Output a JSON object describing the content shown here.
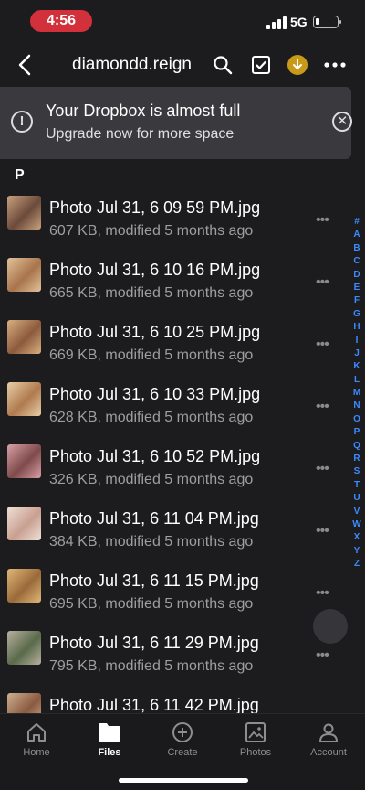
{
  "status": {
    "time": "4:56",
    "network": "5G",
    "battery_level": 0.2
  },
  "nav": {
    "title": "diamondd.reign"
  },
  "banner": {
    "title": "Your Dropbox is almost full",
    "subtitle": "Upgrade now for more space"
  },
  "section_letter": "P",
  "files": [
    {
      "name": "Photo Jul 31, 6 09 59 PM.jpg",
      "meta": "607 KB, modified 5 months ago"
    },
    {
      "name": "Photo Jul 31, 6 10 16 PM.jpg",
      "meta": "665 KB, modified 5 months ago"
    },
    {
      "name": "Photo Jul 31, 6 10 25 PM.jpg",
      "meta": "669 KB, modified 5 months ago"
    },
    {
      "name": "Photo Jul 31, 6 10 33 PM.jpg",
      "meta": "628 KB, modified 5 months ago"
    },
    {
      "name": "Photo Jul 31, 6 10 52 PM.jpg",
      "meta": "326 KB, modified 5 months ago"
    },
    {
      "name": "Photo Jul 31, 6 11 04 PM.jpg",
      "meta": "384 KB, modified 5 months ago"
    },
    {
      "name": "Photo Jul 31, 6 11 15 PM.jpg",
      "meta": "695 KB, modified 5 months ago"
    },
    {
      "name": "Photo Jul 31, 6 11 29 PM.jpg",
      "meta": "795 KB, modified 5 months ago"
    },
    {
      "name": "Photo Jul 31, 6 11 42 PM.jpg",
      "meta": ""
    }
  ],
  "index_letters": [
    "#",
    "A",
    "B",
    "C",
    "D",
    "E",
    "F",
    "G",
    "H",
    "I",
    "J",
    "K",
    "L",
    "M",
    "N",
    "O",
    "P",
    "Q",
    "R",
    "S",
    "T",
    "U",
    "V",
    "W",
    "X",
    "Y",
    "Z"
  ],
  "tabs": [
    {
      "label": "Home",
      "icon": "home-icon"
    },
    {
      "label": "Files",
      "icon": "folder-icon"
    },
    {
      "label": "Create",
      "icon": "plus-circle-icon"
    },
    {
      "label": "Photos",
      "icon": "photo-icon"
    },
    {
      "label": "Account",
      "icon": "person-icon"
    }
  ],
  "active_tab": "Files"
}
